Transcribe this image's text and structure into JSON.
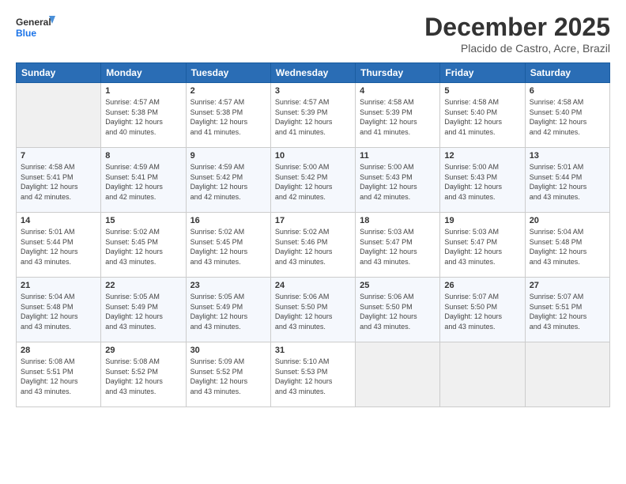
{
  "logo": {
    "line1": "General",
    "line2": "Blue"
  },
  "title": "December 2025",
  "subtitle": "Placido de Castro, Acre, Brazil",
  "weekdays": [
    "Sunday",
    "Monday",
    "Tuesday",
    "Wednesday",
    "Thursday",
    "Friday",
    "Saturday"
  ],
  "weeks": [
    [
      {
        "day": "",
        "info": ""
      },
      {
        "day": "1",
        "info": "Sunrise: 4:57 AM\nSunset: 5:38 PM\nDaylight: 12 hours\nand 40 minutes."
      },
      {
        "day": "2",
        "info": "Sunrise: 4:57 AM\nSunset: 5:38 PM\nDaylight: 12 hours\nand 41 minutes."
      },
      {
        "day": "3",
        "info": "Sunrise: 4:57 AM\nSunset: 5:39 PM\nDaylight: 12 hours\nand 41 minutes."
      },
      {
        "day": "4",
        "info": "Sunrise: 4:58 AM\nSunset: 5:39 PM\nDaylight: 12 hours\nand 41 minutes."
      },
      {
        "day": "5",
        "info": "Sunrise: 4:58 AM\nSunset: 5:40 PM\nDaylight: 12 hours\nand 41 minutes."
      },
      {
        "day": "6",
        "info": "Sunrise: 4:58 AM\nSunset: 5:40 PM\nDaylight: 12 hours\nand 42 minutes."
      }
    ],
    [
      {
        "day": "7",
        "info": "Sunrise: 4:58 AM\nSunset: 5:41 PM\nDaylight: 12 hours\nand 42 minutes."
      },
      {
        "day": "8",
        "info": "Sunrise: 4:59 AM\nSunset: 5:41 PM\nDaylight: 12 hours\nand 42 minutes."
      },
      {
        "day": "9",
        "info": "Sunrise: 4:59 AM\nSunset: 5:42 PM\nDaylight: 12 hours\nand 42 minutes."
      },
      {
        "day": "10",
        "info": "Sunrise: 5:00 AM\nSunset: 5:42 PM\nDaylight: 12 hours\nand 42 minutes."
      },
      {
        "day": "11",
        "info": "Sunrise: 5:00 AM\nSunset: 5:43 PM\nDaylight: 12 hours\nand 42 minutes."
      },
      {
        "day": "12",
        "info": "Sunrise: 5:00 AM\nSunset: 5:43 PM\nDaylight: 12 hours\nand 43 minutes."
      },
      {
        "day": "13",
        "info": "Sunrise: 5:01 AM\nSunset: 5:44 PM\nDaylight: 12 hours\nand 43 minutes."
      }
    ],
    [
      {
        "day": "14",
        "info": "Sunrise: 5:01 AM\nSunset: 5:44 PM\nDaylight: 12 hours\nand 43 minutes."
      },
      {
        "day": "15",
        "info": "Sunrise: 5:02 AM\nSunset: 5:45 PM\nDaylight: 12 hours\nand 43 minutes."
      },
      {
        "day": "16",
        "info": "Sunrise: 5:02 AM\nSunset: 5:45 PM\nDaylight: 12 hours\nand 43 minutes."
      },
      {
        "day": "17",
        "info": "Sunrise: 5:02 AM\nSunset: 5:46 PM\nDaylight: 12 hours\nand 43 minutes."
      },
      {
        "day": "18",
        "info": "Sunrise: 5:03 AM\nSunset: 5:47 PM\nDaylight: 12 hours\nand 43 minutes."
      },
      {
        "day": "19",
        "info": "Sunrise: 5:03 AM\nSunset: 5:47 PM\nDaylight: 12 hours\nand 43 minutes."
      },
      {
        "day": "20",
        "info": "Sunrise: 5:04 AM\nSunset: 5:48 PM\nDaylight: 12 hours\nand 43 minutes."
      }
    ],
    [
      {
        "day": "21",
        "info": "Sunrise: 5:04 AM\nSunset: 5:48 PM\nDaylight: 12 hours\nand 43 minutes."
      },
      {
        "day": "22",
        "info": "Sunrise: 5:05 AM\nSunset: 5:49 PM\nDaylight: 12 hours\nand 43 minutes."
      },
      {
        "day": "23",
        "info": "Sunrise: 5:05 AM\nSunset: 5:49 PM\nDaylight: 12 hours\nand 43 minutes."
      },
      {
        "day": "24",
        "info": "Sunrise: 5:06 AM\nSunset: 5:50 PM\nDaylight: 12 hours\nand 43 minutes."
      },
      {
        "day": "25",
        "info": "Sunrise: 5:06 AM\nSunset: 5:50 PM\nDaylight: 12 hours\nand 43 minutes."
      },
      {
        "day": "26",
        "info": "Sunrise: 5:07 AM\nSunset: 5:50 PM\nDaylight: 12 hours\nand 43 minutes."
      },
      {
        "day": "27",
        "info": "Sunrise: 5:07 AM\nSunset: 5:51 PM\nDaylight: 12 hours\nand 43 minutes."
      }
    ],
    [
      {
        "day": "28",
        "info": "Sunrise: 5:08 AM\nSunset: 5:51 PM\nDaylight: 12 hours\nand 43 minutes."
      },
      {
        "day": "29",
        "info": "Sunrise: 5:08 AM\nSunset: 5:52 PM\nDaylight: 12 hours\nand 43 minutes."
      },
      {
        "day": "30",
        "info": "Sunrise: 5:09 AM\nSunset: 5:52 PM\nDaylight: 12 hours\nand 43 minutes."
      },
      {
        "day": "31",
        "info": "Sunrise: 5:10 AM\nSunset: 5:53 PM\nDaylight: 12 hours\nand 43 minutes."
      },
      {
        "day": "",
        "info": ""
      },
      {
        "day": "",
        "info": ""
      },
      {
        "day": "",
        "info": ""
      }
    ]
  ]
}
